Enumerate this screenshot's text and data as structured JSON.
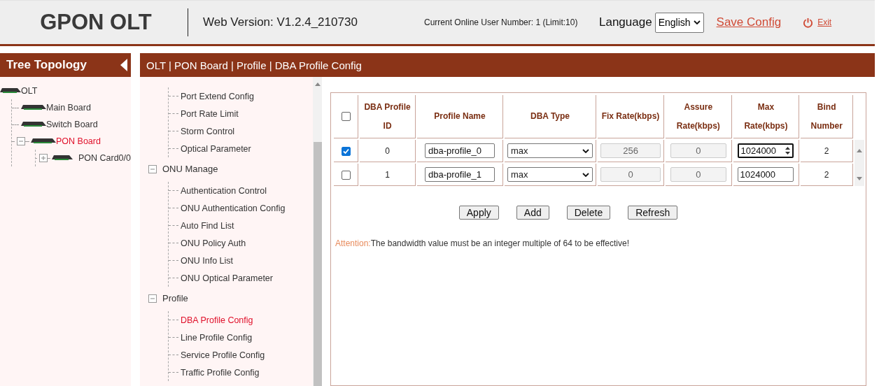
{
  "header": {
    "logo": "GPON OLT",
    "version": "Web Version: V1.2.4_210730",
    "online_users": "Current Online User Number: 1 (Limit:10)",
    "language_label": "Language",
    "language_value": "English",
    "save_link": "Save Config",
    "exit_link": "Exit"
  },
  "sidebar": {
    "title": "Tree Topology",
    "tree": [
      {
        "label": "OLT",
        "selected": false,
        "children": [
          {
            "label": "Main Board",
            "selected": false
          },
          {
            "label": "Switch Board",
            "selected": false
          },
          {
            "label": "PON Board",
            "selected": true,
            "expanded": true,
            "children": [
              {
                "label": "PON Card0/0",
                "selected": false,
                "expanded": false
              }
            ]
          }
        ]
      }
    ]
  },
  "breadcrumb": "OLT | PON Board | Profile | DBA Profile Config",
  "menu": {
    "loose_items": [
      {
        "label": "Port Extend Config",
        "selected": false
      },
      {
        "label": "Port Rate Limit",
        "selected": false
      },
      {
        "label": "Storm Control",
        "selected": false
      },
      {
        "label": "Optical Parameter",
        "selected": false
      }
    ],
    "groups": [
      {
        "label": "ONU Manage",
        "expanded": true,
        "children": [
          {
            "label": "Authentication Control",
            "selected": false
          },
          {
            "label": "ONU Authentication Config",
            "selected": false
          },
          {
            "label": "Auto Find List",
            "selected": false
          },
          {
            "label": "ONU Policy Auth",
            "selected": false
          },
          {
            "label": "ONU Info List",
            "selected": false
          },
          {
            "label": "ONU Optical Parameter",
            "selected": false
          }
        ]
      },
      {
        "label": "Profile",
        "expanded": true,
        "children": [
          {
            "label": "DBA Profile Config",
            "selected": true
          },
          {
            "label": "Line Profile Config",
            "selected": false
          },
          {
            "label": "Service Profile Config",
            "selected": false
          },
          {
            "label": "Traffic Profile Config",
            "selected": false
          }
        ]
      }
    ]
  },
  "table": {
    "header_checked": false,
    "columns": [
      [
        "DBA Profile",
        "ID"
      ],
      [
        "Profile Name"
      ],
      [
        "DBA Type"
      ],
      [
        "Fix Rate(kbps)"
      ],
      [
        "Assure",
        "Rate(kbps)"
      ],
      [
        "Max",
        "Rate(kbps)"
      ],
      [
        "Bind",
        "Number"
      ]
    ],
    "rows": [
      {
        "checked": true,
        "id": "0",
        "name": "dba-profile_0",
        "type": "max",
        "fix_rate": "256",
        "assure_rate": "0",
        "max_rate": "1024000",
        "max_focused": true,
        "bind": "2"
      },
      {
        "checked": false,
        "id": "1",
        "name": "dba-profile_1",
        "type": "max",
        "fix_rate": "0",
        "assure_rate": "0",
        "max_rate": "1024000",
        "max_focused": false,
        "bind": "2"
      }
    ]
  },
  "buttons": [
    "Apply",
    "Add",
    "Delete",
    "Refresh"
  ],
  "attention": {
    "label": "Attention:",
    "text": "The bandwidth value must be an integer multiple of 64 to be effective!"
  }
}
